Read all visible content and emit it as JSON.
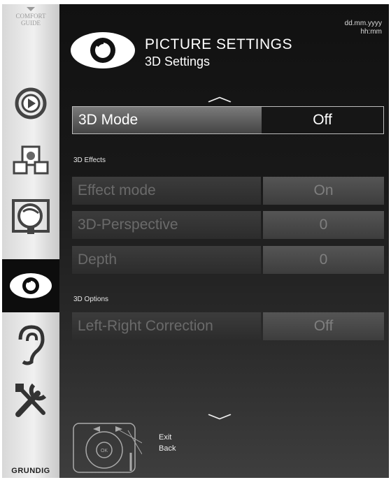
{
  "sidebar": {
    "comfort_guide": "COMFORT GUIDE",
    "brand": "GRUNDIG",
    "items": [
      {
        "name": "source-icon"
      },
      {
        "name": "installation-icon"
      },
      {
        "name": "satellite-icon"
      },
      {
        "name": "eye-icon",
        "active": true
      },
      {
        "name": "ear-icon"
      },
      {
        "name": "tools-icon"
      }
    ]
  },
  "header": {
    "title": "PICTURE SETTINGS",
    "subtitle": "3D Settings",
    "date": "dd.mm.yyyy",
    "time": "hh:mm"
  },
  "menu": {
    "mode": {
      "label": "3D Mode",
      "value": "Off"
    },
    "effects_header": "3D Effects",
    "effect_mode": {
      "label": "Effect mode",
      "value": "On"
    },
    "perspective": {
      "label": "3D-Perspective",
      "value": "0"
    },
    "depth": {
      "label": "Depth",
      "value": "0"
    },
    "options_header": "3D Options",
    "lr_correction": {
      "label": "Left-Right Correction",
      "value": "Off"
    }
  },
  "footer": {
    "exit": "Exit",
    "back": "Back",
    "ok": "OK"
  },
  "colors": {
    "background": "#0d0d0d",
    "sidebar": "#e6e6e6",
    "active_row": "#6e6e6e",
    "disabled_text": "#6a6a6a"
  }
}
